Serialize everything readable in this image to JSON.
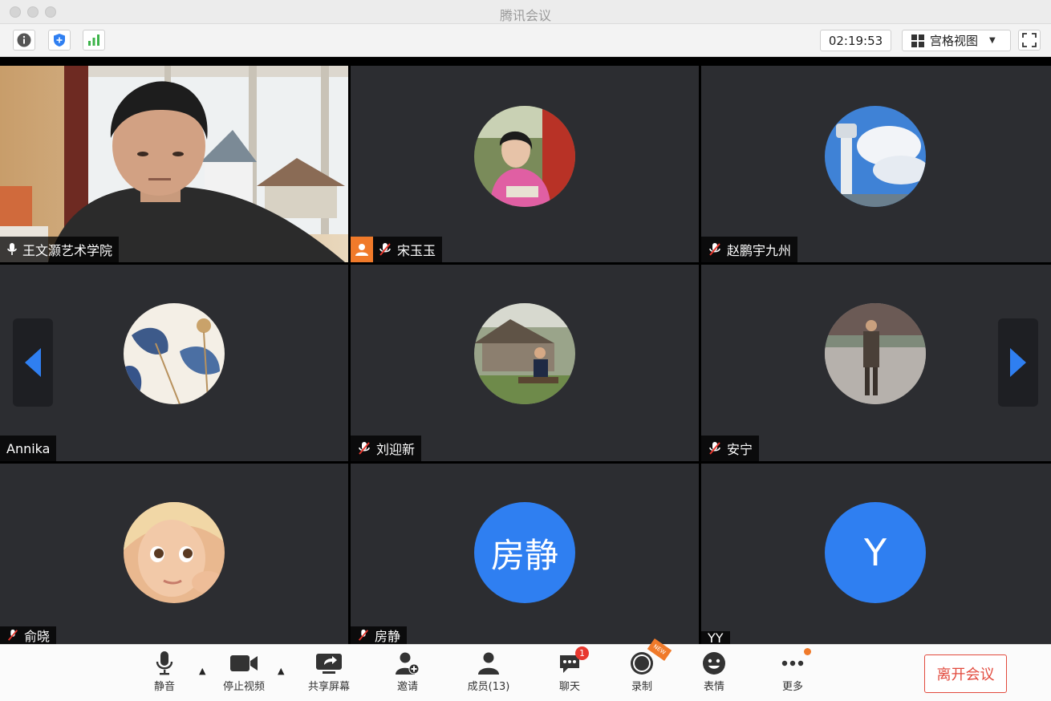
{
  "window": {
    "title": "腾讯会议"
  },
  "toolbar": {
    "timer": "02:19:53",
    "view_mode": "宫格视图",
    "icons": [
      "info-icon",
      "security-shield-icon",
      "network-signal-icon",
      "fullscreen-icon"
    ]
  },
  "participants": [
    {
      "name": "王文灏艺术学院",
      "mic": "on",
      "video": true
    },
    {
      "name": "宋玉玉",
      "mic": "muted",
      "host": true
    },
    {
      "name": "赵鹏宇九州",
      "mic": "muted"
    },
    {
      "name": "Annika",
      "mic": "none"
    },
    {
      "name": "刘迎新",
      "mic": "muted"
    },
    {
      "name": "安宁",
      "mic": "muted"
    },
    {
      "name": "俞晓",
      "mic": "muted"
    },
    {
      "name": "房静",
      "mic": "muted",
      "initials": "房静"
    },
    {
      "name": "YY",
      "mic": "none",
      "initials": "Y"
    }
  ],
  "nameplates_partial": {
    "p7": "俞晓",
    "p8": "房静",
    "p9": "YY"
  },
  "controls": {
    "mute": "静音",
    "stop_video": "停止视频",
    "share_screen": "共享屏幕",
    "invite": "邀请",
    "members": "成员(13)",
    "chat": "聊天",
    "chat_badge": "1",
    "record": "录制",
    "record_tag": "NEW",
    "emoji": "表情",
    "more": "更多",
    "leave": "离开会议"
  },
  "colors": {
    "accent_blue": "#2f7ff1",
    "host_orange": "#f07a2a",
    "leave_red": "#e24a3d",
    "tile_bg": "#2c2d31"
  }
}
